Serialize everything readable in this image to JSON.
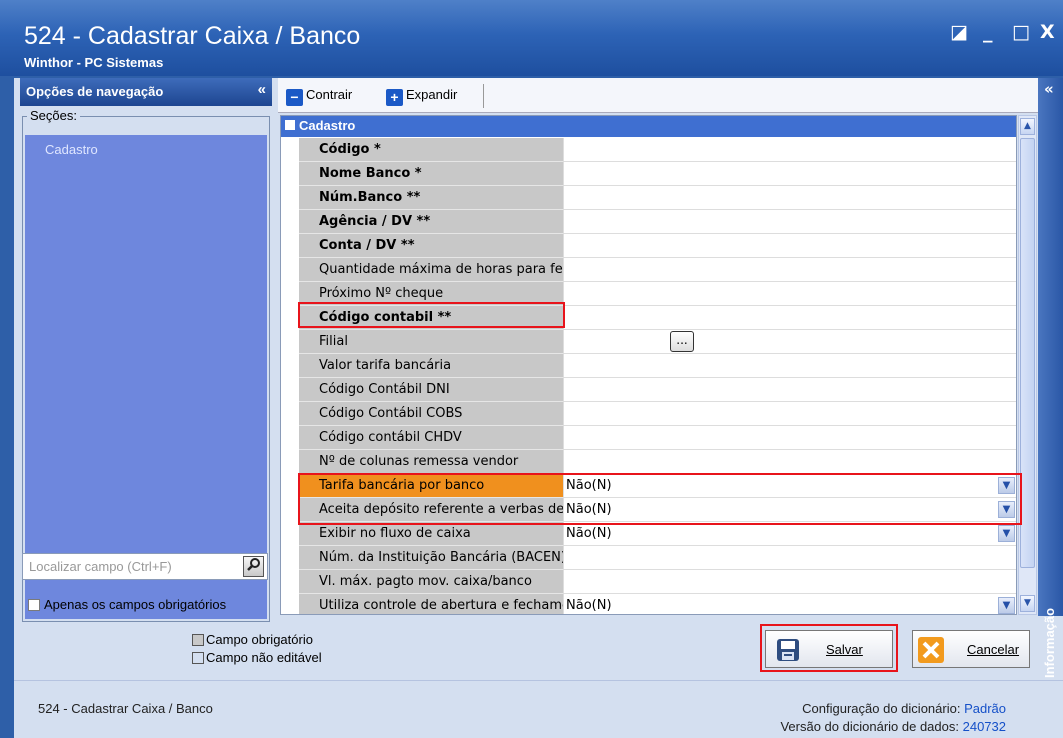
{
  "window": {
    "title": "524 - Cadastrar Caixa / Banco",
    "subtitle": "Winthor - PC Sistemas",
    "controls": [
      "◪",
      "_",
      "□",
      "X"
    ]
  },
  "nav": {
    "header": "Opções de navegação",
    "collapse": "«",
    "sections_label": "Seções:",
    "sections": [
      "Cadastro"
    ],
    "search_placeholder": "Localizar campo (Ctrl+F)",
    "only_required_label": "Apenas os campos obrigatórios"
  },
  "toolbar": {
    "collapse_label": "Contrair",
    "expand_label": "Expandir"
  },
  "grid": {
    "category": "Cadastro",
    "rows": [
      {
        "name": "Código *",
        "value": "",
        "bold": true
      },
      {
        "name": "Nome Banco *",
        "value": "",
        "bold": true
      },
      {
        "name": "Núm.Banco **",
        "value": "",
        "bold": true
      },
      {
        "name": "Agência / DV **",
        "value": "",
        "bold": true
      },
      {
        "name": "Conta / DV **",
        "value": "",
        "bold": true
      },
      {
        "name": "Quantidade máxima de horas para fe",
        "value": ""
      },
      {
        "name": "Próximo Nº cheque",
        "value": ""
      },
      {
        "name": "Código contabil **",
        "value": "",
        "bold": true
      },
      {
        "name": "Filial",
        "value": "",
        "ellipsis": "..."
      },
      {
        "name": "Valor tarifa bancária",
        "value": ""
      },
      {
        "name": "Código Contábil DNI",
        "value": ""
      },
      {
        "name": "Código Contábil COBS",
        "value": ""
      },
      {
        "name": "Código contábil CHDV",
        "value": ""
      },
      {
        "name": "Nº de colunas remessa vendor",
        "value": ""
      },
      {
        "name": "Tarifa bancária por banco",
        "value": "Não(N)",
        "dropdown": true,
        "highlight": true
      },
      {
        "name": "Aceita depósito referente a verbas de",
        "value": "Não(N)",
        "dropdown": true
      },
      {
        "name": "Exibir no fluxo de caixa",
        "value": "Não(N)",
        "dropdown": true
      },
      {
        "name": "Núm. da Instituição Bancária (BACEN)",
        "value": ""
      },
      {
        "name": "Vl. máx. pagto mov. caixa/banco",
        "value": ""
      },
      {
        "name": "Utiliza controle de abertura e fechame",
        "value": "Não(N)",
        "dropdown": true
      }
    ]
  },
  "info_panel": {
    "label": "Informação",
    "collapse": "«"
  },
  "legend": {
    "required": "Campo obrigatório",
    "not_editable": "Campo não editável"
  },
  "buttons": {
    "save": "Salvar",
    "cancel": "Cancelar"
  },
  "footer": {
    "left": "524 - Cadastrar Caixa / Banco",
    "dict_config_label": "Configuração do dicionário:",
    "dict_config_value": "Padrão",
    "dict_version_label": "Versão do dicionário de dados:",
    "dict_version_value": "240732"
  },
  "colors": {
    "title_blue": "#2d63b6",
    "category_blue": "#3f6fd1",
    "highlight_orange": "#f0901e",
    "annotation_red": "#e8141b",
    "required_swatch": "#c8c8c8",
    "not_editable_swatch": "#d4dff0"
  }
}
